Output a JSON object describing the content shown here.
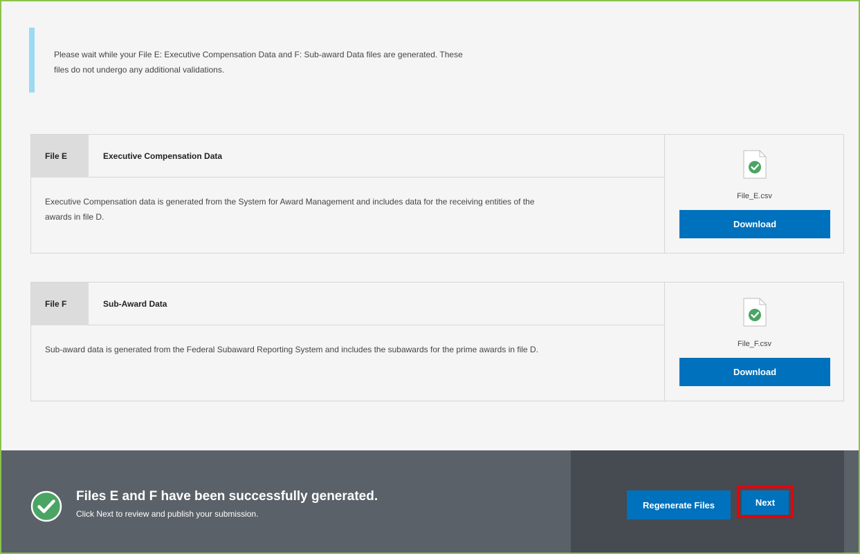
{
  "notice": {
    "line1": "Please wait while your File E: Executive Compensation Data and F: Sub-award Data files are generated. These",
    "line2": "files do not undergo any additional validations."
  },
  "files": [
    {
      "tag": "File E",
      "title": "Executive Compensation Data",
      "description_line1": "Executive Compensation data is generated from the System for Award Management and includes data for the receiving entities of the",
      "description_line2": "awards in file D.",
      "file_name": "File_E.csv",
      "download_label": "Download",
      "icon": "file-check-icon"
    },
    {
      "tag": "File F",
      "title": "Sub-Award Data",
      "description_line1": "Sub-award data is generated from the Federal Subaward Reporting System and includes the subawards for the prime awards in file D.",
      "description_line2": "",
      "file_name": "File_F.csv",
      "download_label": "Download",
      "icon": "file-check-icon"
    }
  ],
  "footer": {
    "title": "Files E and F have been successfully generated.",
    "subtitle": "Click Next to review and publish your submission.",
    "regenerate_label": "Regenerate Files",
    "next_label": "Next",
    "icon": "success-check-icon"
  },
  "colors": {
    "accent_blue": "#0071bc",
    "success_green": "#4aa564",
    "highlight_red": "#e8000b",
    "frame_green": "#8bc34a"
  }
}
